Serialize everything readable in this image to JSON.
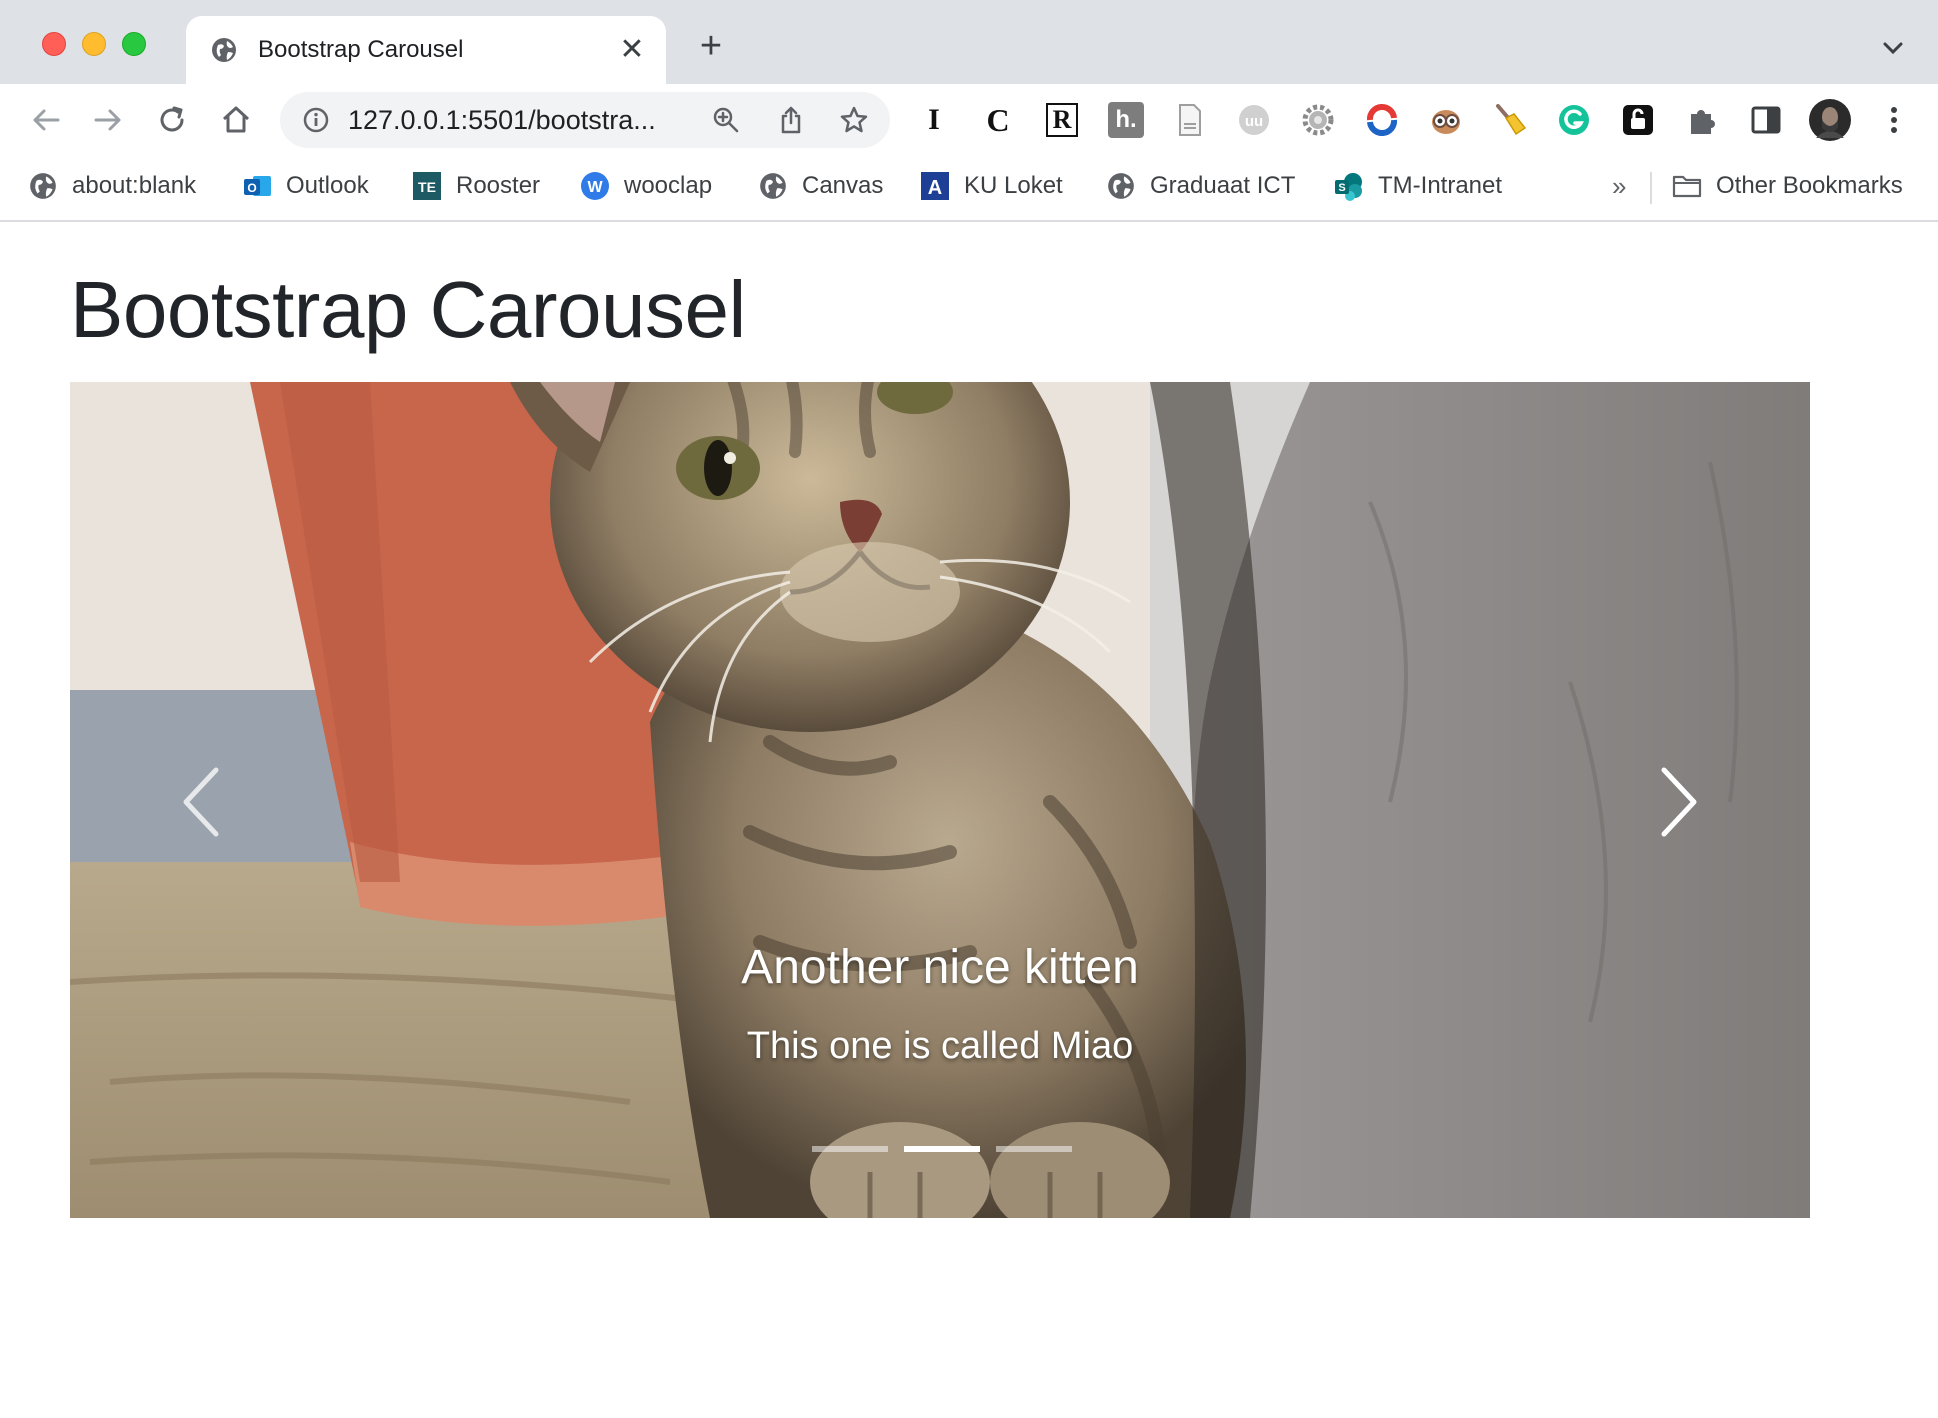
{
  "browser": {
    "tab": {
      "title": "Bootstrap Carousel",
      "close_glyph": "✕"
    },
    "new_tab_glyph": "+",
    "address": {
      "url": "127.0.0.1:5501/bootstra..."
    },
    "extensions": [
      {
        "name": "instapaper-extension-icon",
        "label": "I"
      },
      {
        "name": "c-extension-icon",
        "label": "C"
      },
      {
        "name": "r-extension-icon",
        "label": "R"
      },
      {
        "name": "h-extension-icon",
        "label": "h."
      }
    ]
  },
  "bookmarks": {
    "items": [
      {
        "label": "about:blank",
        "icon": "globe-icon"
      },
      {
        "label": "Outlook",
        "icon": "outlook-icon"
      },
      {
        "label": "Rooster",
        "icon": "te-icon",
        "badge": "TE"
      },
      {
        "label": "wooclap",
        "icon": "wooclap-icon",
        "badge": "W"
      },
      {
        "label": "Canvas",
        "icon": "globe-icon"
      },
      {
        "label": "KU Loket",
        "icon": "ku-icon",
        "badge": "A"
      },
      {
        "label": "Graduaat ICT",
        "icon": "globe-icon"
      },
      {
        "label": "TM-Intranet",
        "icon": "sharepoint-icon",
        "badge": "S"
      }
    ],
    "overflow_glyph": "»",
    "other": "Other Bookmarks"
  },
  "page": {
    "title": "Bootstrap Carousel",
    "carousel": {
      "caption_title": "Another nice kitten",
      "caption_text": "This one is called Miao",
      "slide_count": 3,
      "active_index": 1
    }
  },
  "colors": {
    "tabstrip": "#dee1e6",
    "omnibox": "#f1f3f4",
    "heading": "#212529",
    "pot": "#c8664c",
    "wall": "#8f8b88"
  }
}
